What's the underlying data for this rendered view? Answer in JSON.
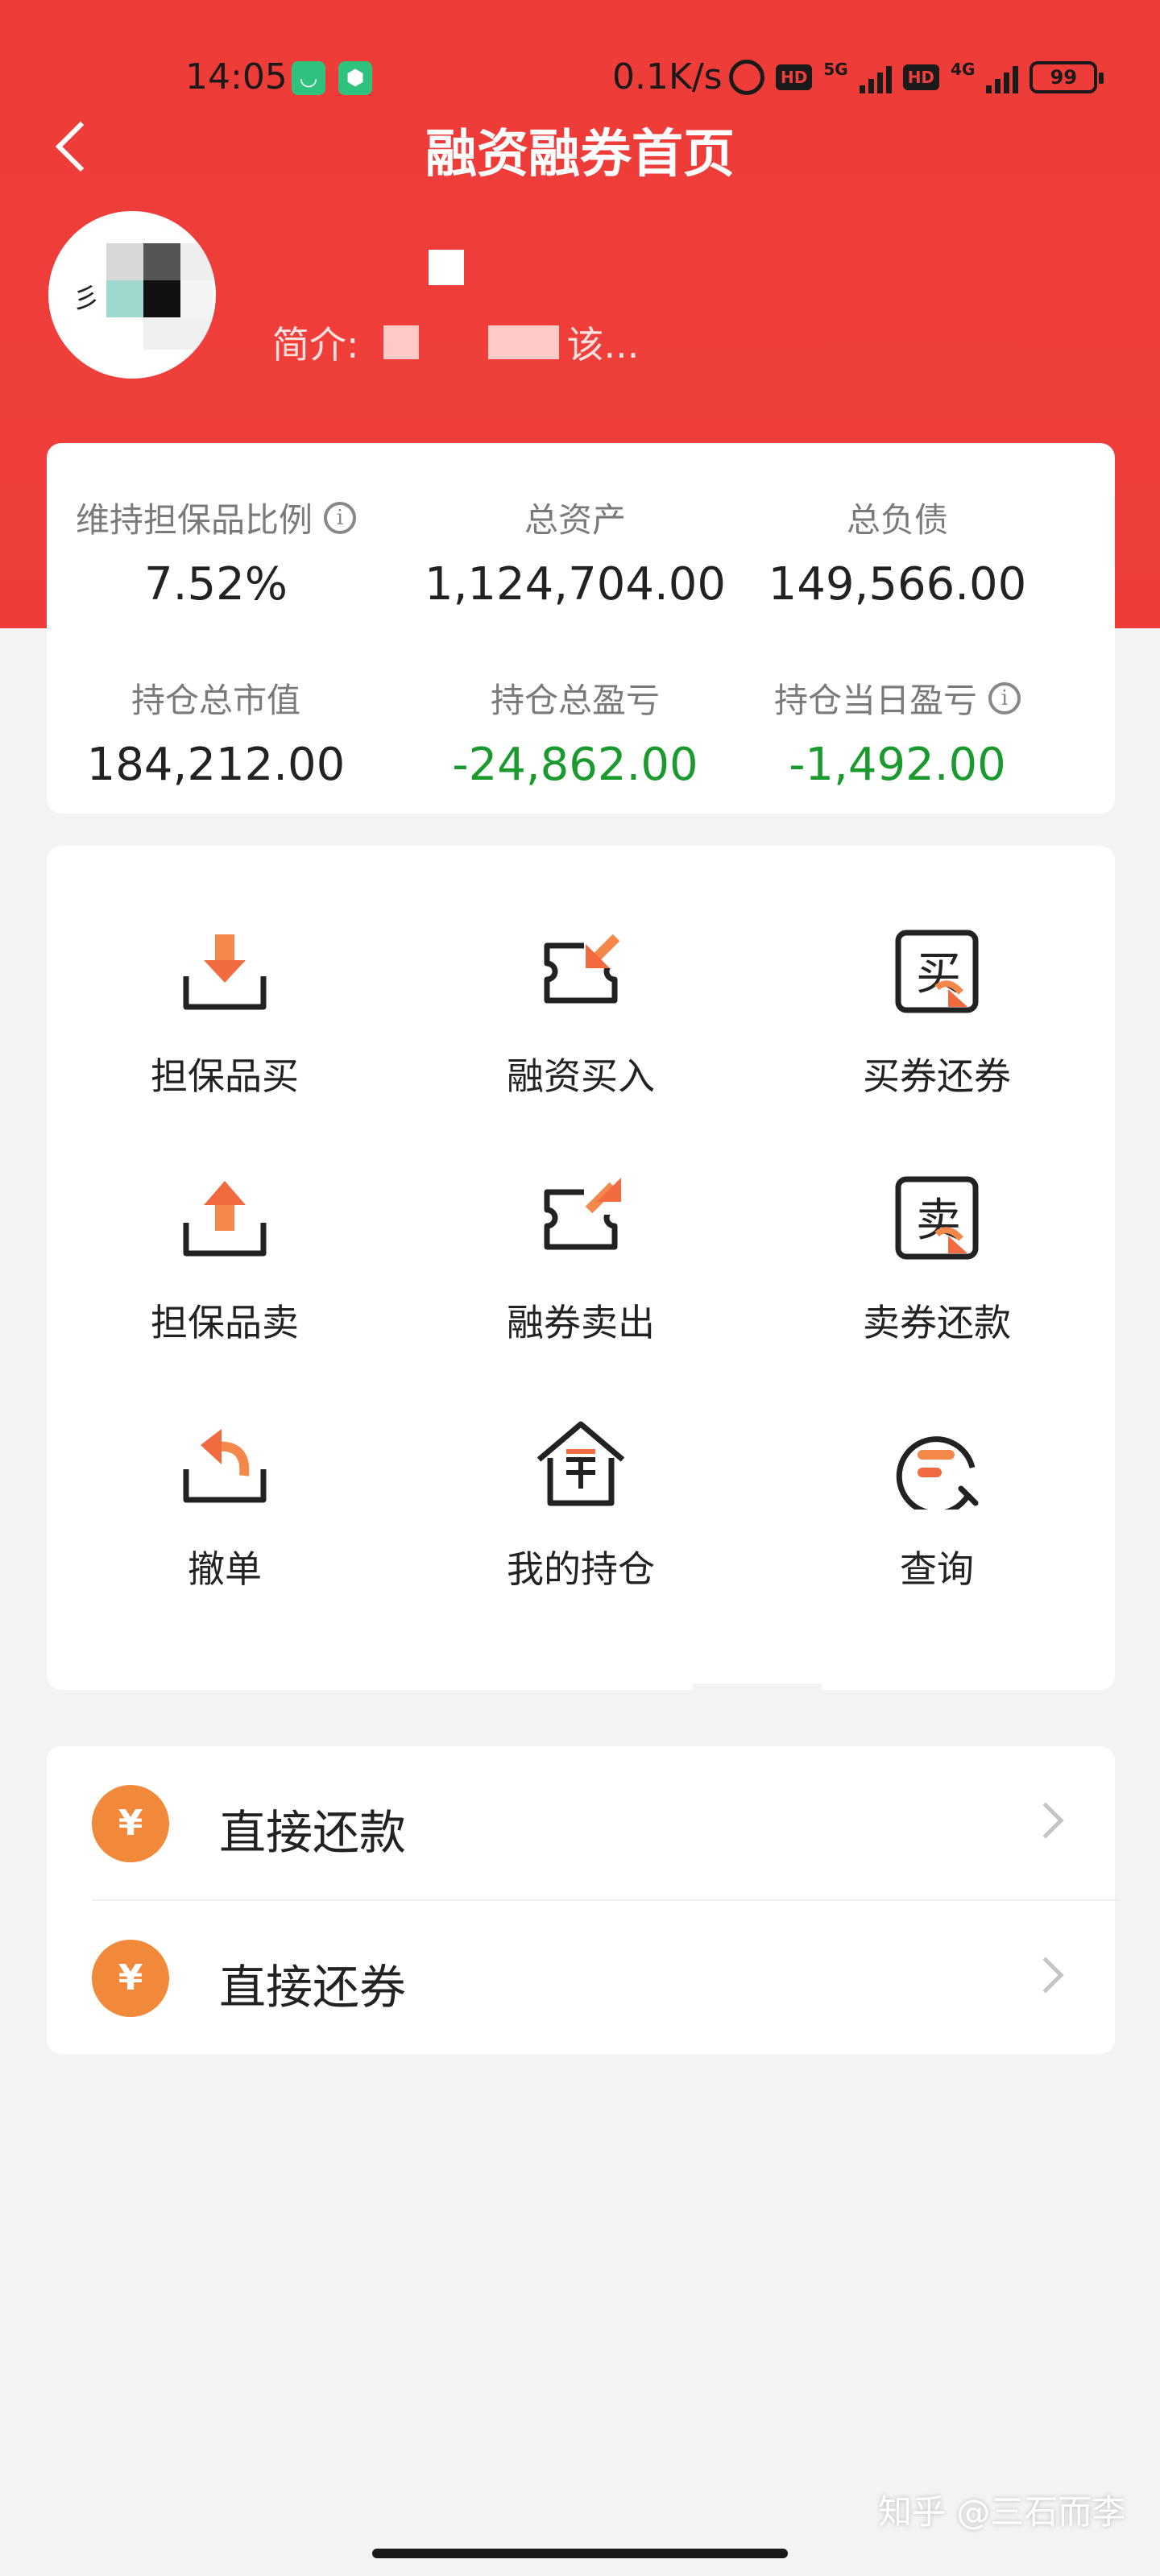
{
  "status_bar": {
    "time": "14:05",
    "speed": "0.1K/s",
    "network_1": "5G",
    "network_2": "4G",
    "hd": "HD",
    "battery": "99"
  },
  "nav": {
    "title": "融资融券首页"
  },
  "profile": {
    "intro_label": "简介:",
    "intro_tail": "该..."
  },
  "stats": [
    {
      "label": "维持担保品比例",
      "value": "7.52%",
      "info": "i",
      "value_color": "#222222"
    },
    {
      "label": "总资产",
      "value": "1,124,704.00",
      "value_color": "#222222"
    },
    {
      "label": "总负债",
      "value": "149,566.00",
      "value_color": "#222222"
    },
    {
      "label": "持仓总市值",
      "value": "184,212.00",
      "value_color": "#222222"
    },
    {
      "label": "持仓总盈亏",
      "value": "-24,862.00",
      "value_color": "#1a9a2c"
    },
    {
      "label": "持仓当日盈亏",
      "value": "-1,492.00",
      "info": "i",
      "value_color": "#1a9a2c"
    }
  ],
  "actions": [
    {
      "label": "担保品买",
      "icon": "collateral-buy-icon"
    },
    {
      "label": "融资买入",
      "icon": "margin-buy-icon"
    },
    {
      "label": "买券还券",
      "icon": "buy-return-icon"
    },
    {
      "label": "担保品卖",
      "icon": "collateral-sell-icon"
    },
    {
      "label": "融券卖出",
      "icon": "short-sell-icon"
    },
    {
      "label": "卖券还款",
      "icon": "sell-repay-icon"
    },
    {
      "label": "撤单",
      "icon": "cancel-order-icon"
    },
    {
      "label": "我的持仓",
      "icon": "my-position-icon"
    },
    {
      "label": "查询",
      "icon": "query-icon"
    }
  ],
  "repay": [
    {
      "label": "直接还款",
      "icon_glyph": "¥"
    },
    {
      "label": "直接还券",
      "icon_glyph": "¥"
    }
  ],
  "watermark": "知乎 @三石而李",
  "colors": {
    "brand_red": "#ef3f3b",
    "loss_green": "#1a9a2c",
    "icon_orange": "#f08a3a"
  }
}
